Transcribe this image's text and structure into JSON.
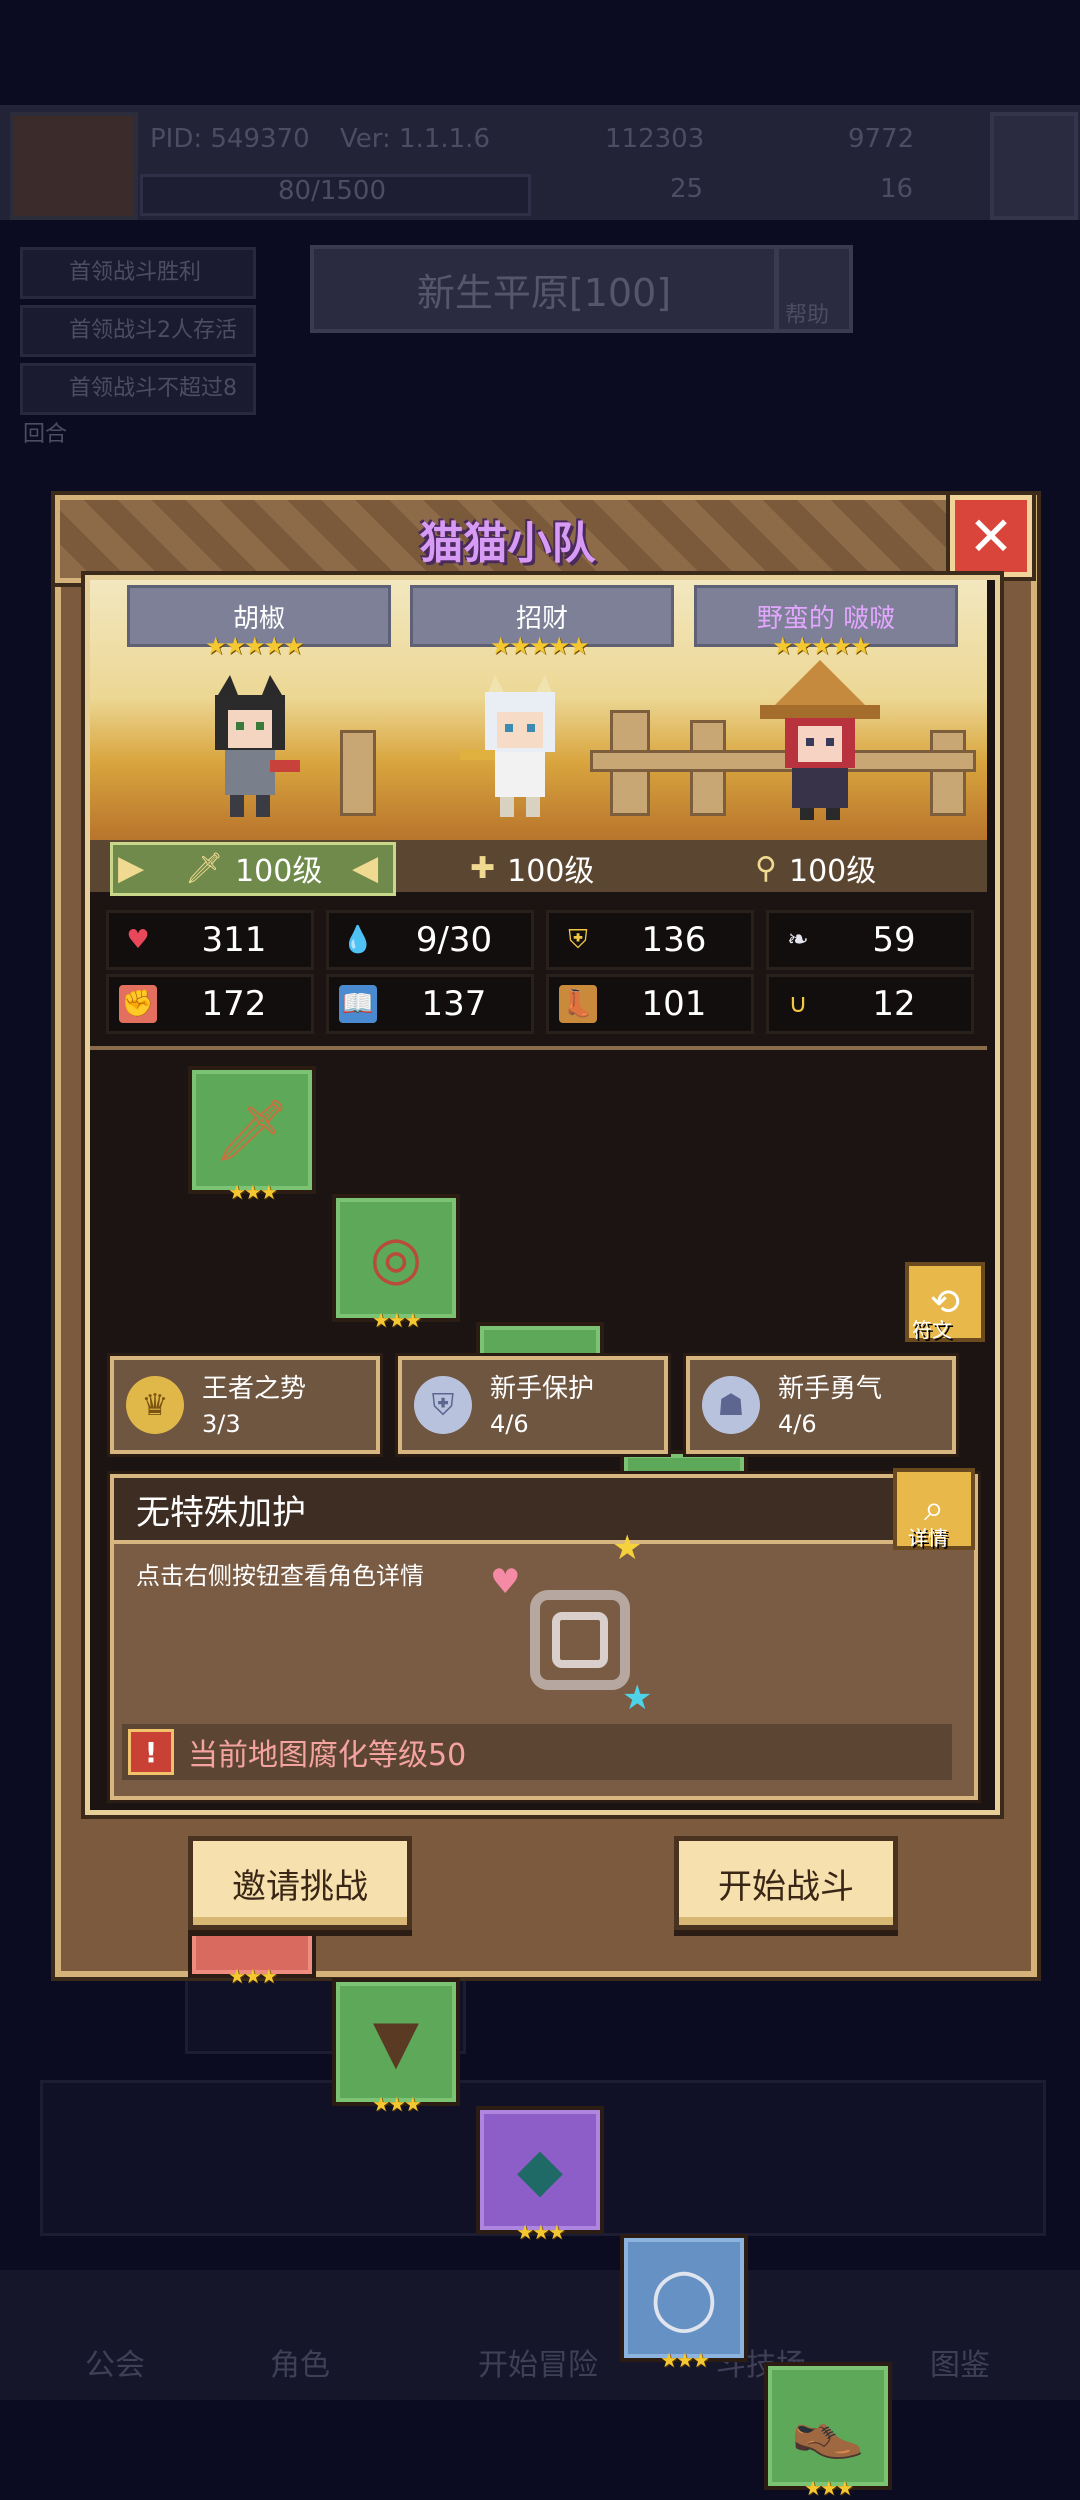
{
  "background": {
    "pid": "PID: 549370",
    "version": "Ver: 1.1.1.6",
    "currency_a": "112303",
    "currency_b": "9772",
    "stamina": "80/1500",
    "clover": "25",
    "key_count": "16",
    "quests": [
      "首领战斗胜利",
      "首领战斗2人存活",
      "首领战斗不超过8回合"
    ],
    "map_title": "新生平原[100]",
    "help_label": "帮助",
    "nav": [
      "公会",
      "角色",
      "开始冒险",
      "斗技场",
      "图鉴"
    ]
  },
  "dialog": {
    "title": "猫猫小队",
    "close_icon": "close-icon",
    "characters": [
      {
        "name": "胡椒",
        "stars": "★★★★★",
        "level": "100级",
        "name_color": "#ffffff"
      },
      {
        "name": "招财",
        "stars": "★★★★★",
        "level": "100级",
        "name_color": "#ffffff"
      },
      {
        "name": "野蛮的 啵啵",
        "stars": "★★★★★",
        "level": "100级",
        "name_color": "#e3a6ff"
      }
    ],
    "stats": [
      {
        "icon": "heart-icon",
        "value": "311"
      },
      {
        "icon": "mana-drop-icon",
        "value": "9/30"
      },
      {
        "icon": "shield-icon",
        "value": "136"
      },
      {
        "icon": "wing-icon",
        "value": "59"
      },
      {
        "icon": "fist-icon",
        "value": "172"
      },
      {
        "icon": "spellbook-icon",
        "value": "137"
      },
      {
        "icon": "boot-icon",
        "value": "101"
      },
      {
        "icon": "horseshoe-icon",
        "value": "12"
      }
    ],
    "equipment_stars": "★★★",
    "equipment": [
      {
        "icon": "wooden-sword-icon",
        "rarity": "green"
      },
      {
        "icon": "round-shield-icon",
        "rarity": "green"
      },
      {
        "icon": "necklace-icon",
        "rarity": "green"
      },
      {
        "icon": "coin-emblem-icon",
        "rarity": "green"
      },
      {
        "icon": "steel-helmet-icon",
        "rarity": "blue"
      },
      {
        "icon": "straw-hat-icon",
        "rarity": "red"
      },
      {
        "icon": "leather-armor-icon",
        "rarity": "green"
      },
      {
        "icon": "cloak-icon",
        "rarity": "purple"
      },
      {
        "icon": "silver-ring-icon",
        "rarity": "blue"
      },
      {
        "icon": "leather-boots-icon",
        "rarity": "green"
      }
    ],
    "rune_label": "符文",
    "buffs": [
      {
        "name": "王者之势",
        "count": "3/3",
        "icon": "crown-badge-icon"
      },
      {
        "name": "新手保护",
        "count": "4/6",
        "icon": "shield-badge-icon"
      },
      {
        "name": "新手勇气",
        "count": "4/6",
        "icon": "helmet-badge-icon"
      }
    ],
    "guard": {
      "title": "无特殊加护",
      "detail_label": "详情",
      "hint": "点击右侧按钮查看角色详情",
      "warning": "当前地图腐化等级50"
    },
    "buttons": {
      "invite": "邀请挑战",
      "start": "开始战斗"
    }
  }
}
